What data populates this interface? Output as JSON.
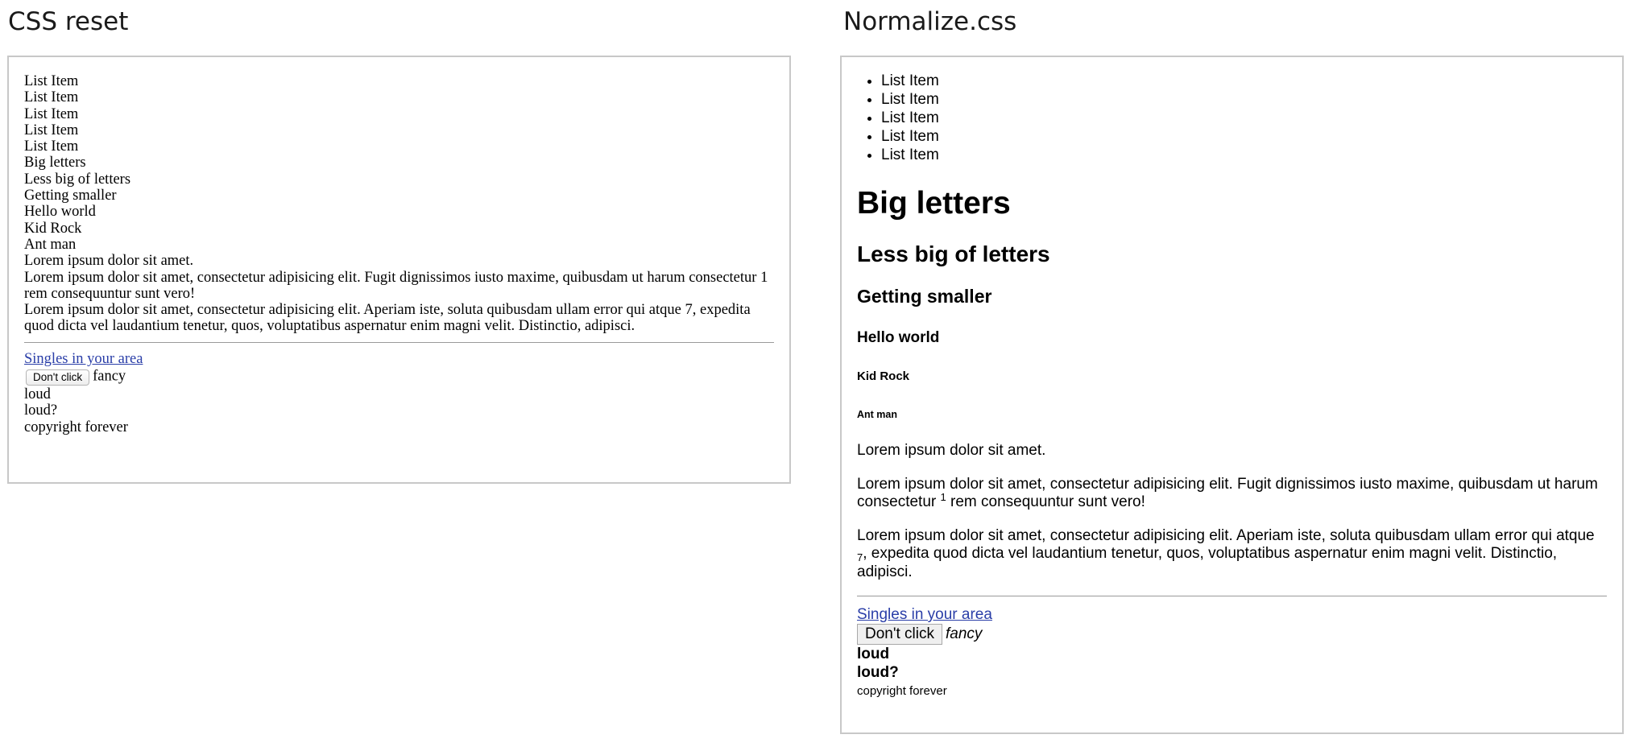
{
  "headings": {
    "left": "CSS reset",
    "right": "Normalize.css"
  },
  "content": {
    "list_items": [
      "List Item",
      "List Item",
      "List Item",
      "List Item",
      "List Item"
    ],
    "h1": "Big letters",
    "h2": "Less big of letters",
    "h3": "Getting smaller",
    "h4": "Hello world",
    "h5": "Kid Rock",
    "h6": "Ant man",
    "p1": "Lorem ipsum dolor sit amet.",
    "p2_before": "Lorem ipsum dolor sit amet, consectetur adipisicing elit. Fugit dignissimos iusto maxime, quibusdam ut harum consectetur ",
    "p2_sup": "1",
    "p2_after": " rem consequuntur sunt vero!",
    "p3_before": "Lorem ipsum dolor sit amet, consectetur adipisicing elit. Aperiam iste, soluta quibusdam ullam error qui atque ",
    "p3_sub": "7",
    "p3_after": ", expedita quod dicta vel laudantium tenetur, quos, voluptatibus aspernatur enim magni velit. Distinctio, adipisci.",
    "link": "Singles in your area",
    "button": "Don't click",
    "em": "fancy",
    "strong1": "loud",
    "strong2": "loud?",
    "small": "copyright forever"
  },
  "colors": {
    "link": "#2a3ea8",
    "border": "#c8c8c8",
    "rule": "#9a9a9a"
  }
}
